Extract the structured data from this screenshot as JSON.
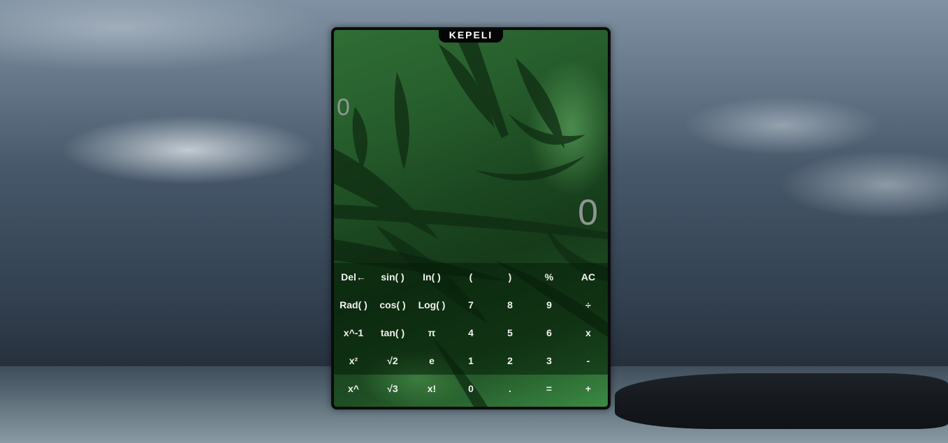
{
  "app": {
    "logo_text": "KEPELI"
  },
  "display": {
    "expression": "0",
    "result": "0"
  },
  "keys": [
    [
      "Del←",
      "sin( )",
      "In( )",
      "(",
      ")",
      "%",
      "AC"
    ],
    [
      "Rad( )",
      "cos( )",
      "Log( )",
      "7",
      "8",
      "9",
      "÷"
    ],
    [
      "x^-1",
      "tan( )",
      "π",
      "4",
      "5",
      "6",
      "x"
    ],
    [
      "x²",
      "√2",
      "e",
      "1",
      "2",
      "3",
      "-"
    ],
    [
      "x^",
      "√3",
      "x!",
      "0",
      ".",
      "=",
      "+"
    ]
  ],
  "colors": {
    "calc_border": "#0b0b0b",
    "key_text": "#f2f2f2",
    "display_text": "#8f9a90"
  }
}
